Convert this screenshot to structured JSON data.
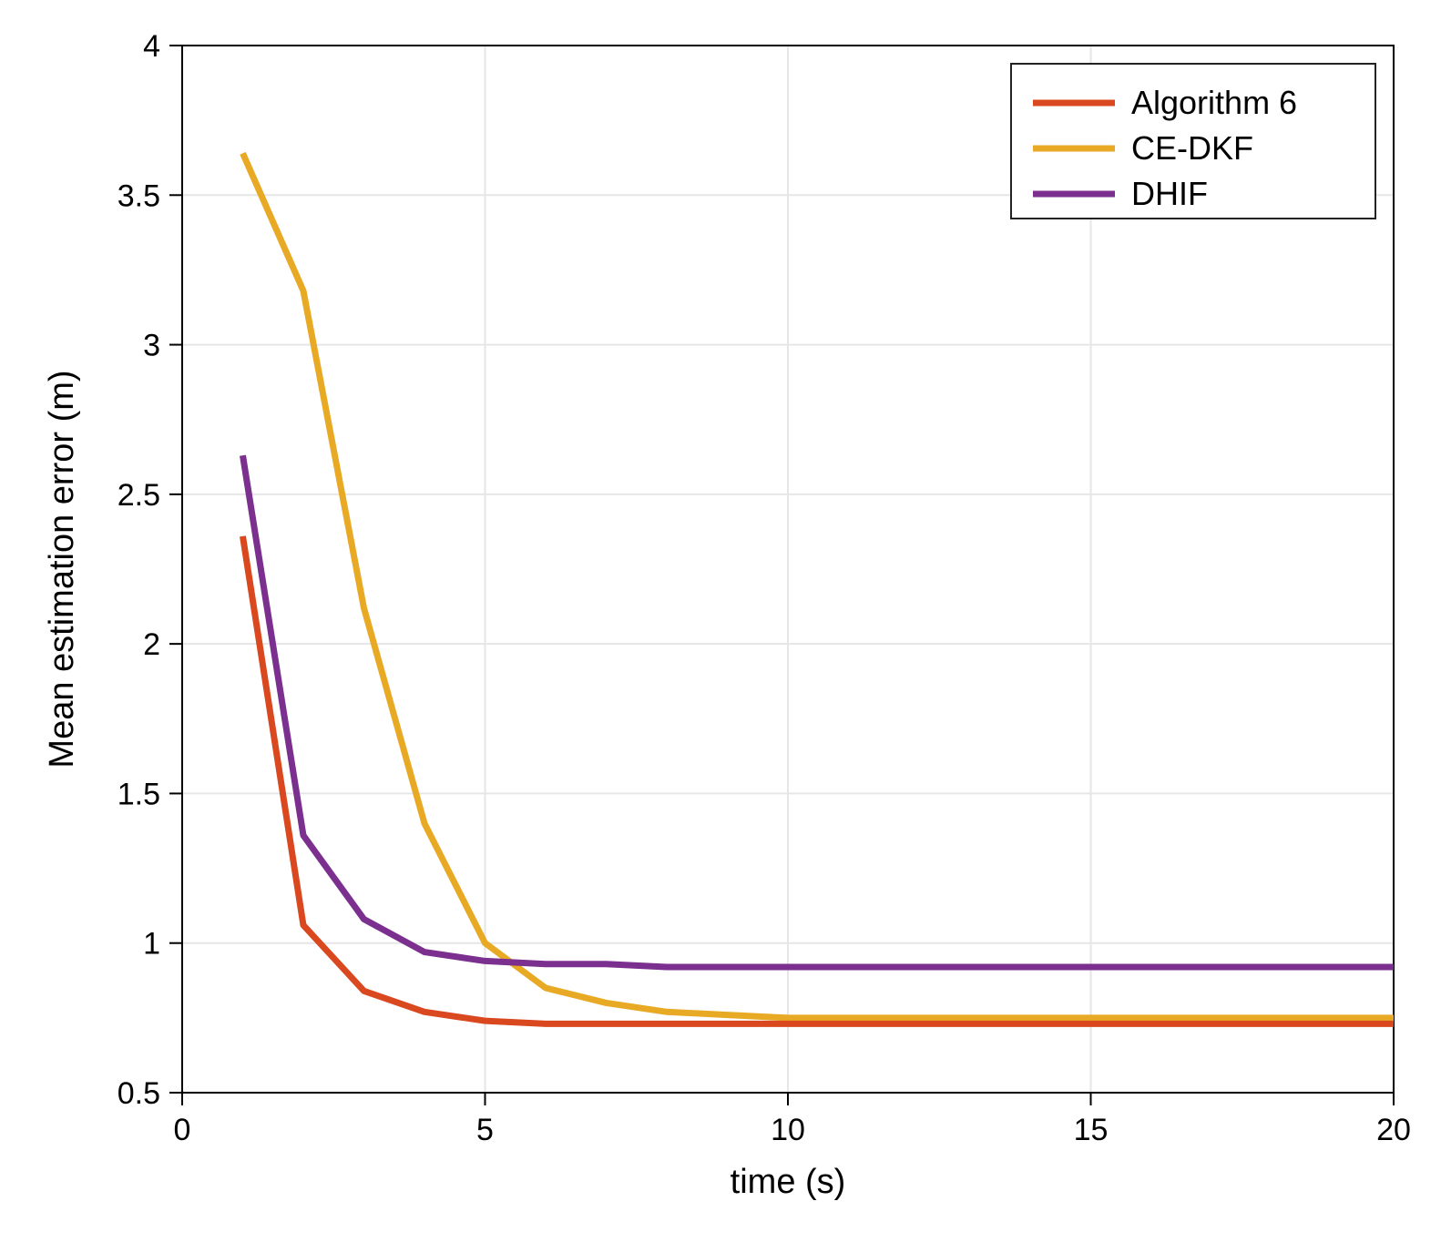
{
  "chart_data": {
    "type": "line",
    "xlabel": "time (s)",
    "ylabel": "Mean estimation error (m)",
    "xlim": [
      0,
      20
    ],
    "ylim": [
      0.5,
      4
    ],
    "xticks": [
      0,
      5,
      10,
      15,
      20
    ],
    "yticks": [
      0.5,
      1,
      1.5,
      2,
      2.5,
      3,
      3.5,
      4
    ],
    "legend_position": "top-right",
    "series": [
      {
        "name": "Algorithm 6",
        "color": "#d9481f",
        "x": [
          1,
          2,
          3,
          4,
          5,
          6,
          7,
          8,
          9,
          10,
          11,
          12,
          13,
          14,
          15,
          16,
          17,
          18,
          19,
          20
        ],
        "y": [
          2.36,
          1.06,
          0.84,
          0.77,
          0.74,
          0.73,
          0.73,
          0.73,
          0.73,
          0.73,
          0.73,
          0.73,
          0.73,
          0.73,
          0.73,
          0.73,
          0.73,
          0.73,
          0.73,
          0.73
        ]
      },
      {
        "name": "CE-DKF",
        "color": "#e8aa24",
        "x": [
          1,
          2,
          3,
          4,
          5,
          6,
          7,
          8,
          9,
          10,
          11,
          12,
          13,
          14,
          15,
          16,
          17,
          18,
          19,
          20
        ],
        "y": [
          3.64,
          3.18,
          2.12,
          1.4,
          1.0,
          0.85,
          0.8,
          0.77,
          0.76,
          0.75,
          0.75,
          0.75,
          0.75,
          0.75,
          0.75,
          0.75,
          0.75,
          0.75,
          0.75,
          0.75
        ]
      },
      {
        "name": "DHIF",
        "color": "#7b2f8f",
        "x": [
          1,
          2,
          3,
          4,
          5,
          6,
          7,
          8,
          9,
          10,
          11,
          12,
          13,
          14,
          15,
          16,
          17,
          18,
          19,
          20
        ],
        "y": [
          2.63,
          1.36,
          1.08,
          0.97,
          0.94,
          0.93,
          0.93,
          0.92,
          0.92,
          0.92,
          0.92,
          0.92,
          0.92,
          0.92,
          0.92,
          0.92,
          0.92,
          0.92,
          0.92,
          0.92
        ]
      }
    ]
  }
}
